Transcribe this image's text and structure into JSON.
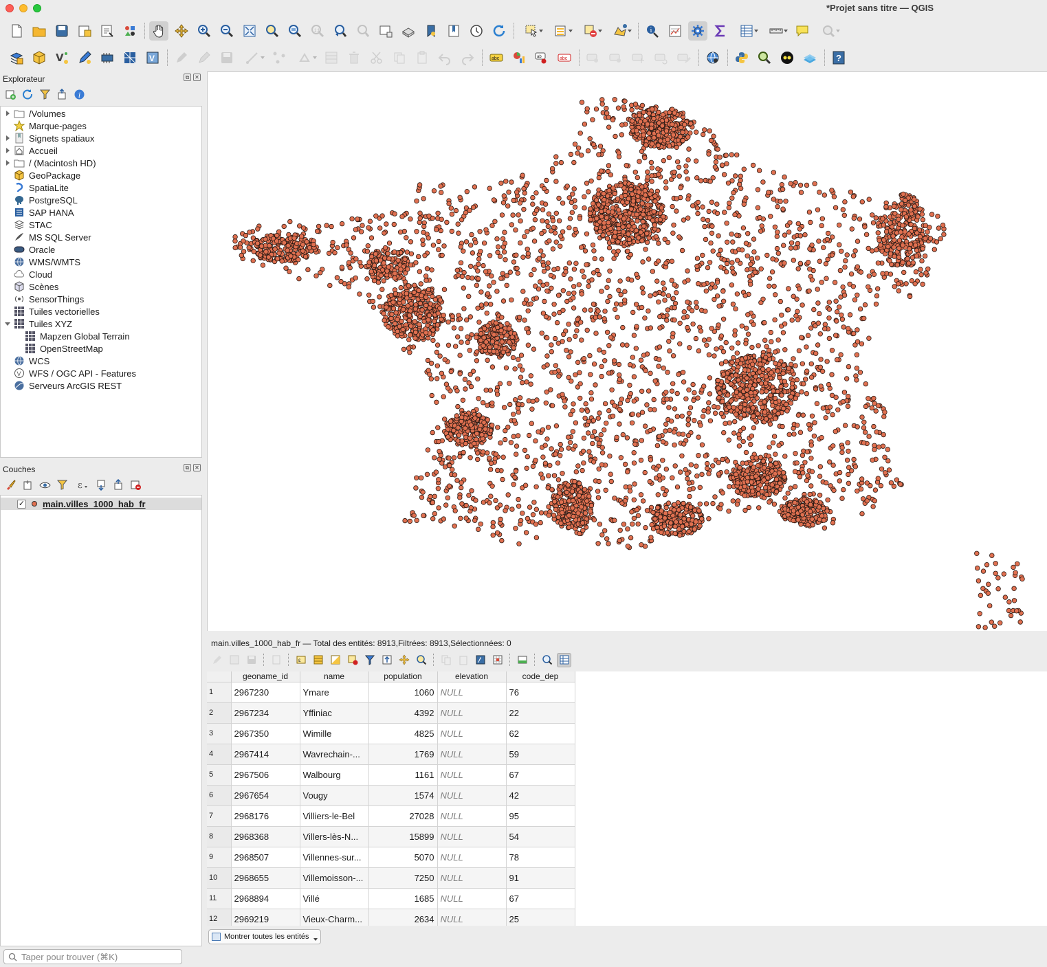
{
  "window": {
    "title": "*Projet sans titre — QGIS"
  },
  "explorer": {
    "title": "Explorateur",
    "items": [
      {
        "label": "/Volumes",
        "icon": "folder-icon",
        "arrow": "right",
        "indent": 0
      },
      {
        "label": "Marque-pages",
        "icon": "star-icon",
        "arrow": "none",
        "indent": 0
      },
      {
        "label": "Signets spatiaux",
        "icon": "bookmark-icon",
        "arrow": "right",
        "indent": 0
      },
      {
        "label": "Accueil",
        "icon": "home-icon",
        "arrow": "right",
        "indent": 0
      },
      {
        "label": "/ (Macintosh HD)",
        "icon": "folder-icon",
        "arrow": "right",
        "indent": 0
      },
      {
        "label": "GeoPackage",
        "icon": "geopackage-icon",
        "arrow": "none",
        "indent": 0
      },
      {
        "label": "SpatiaLite",
        "icon": "spatialite-icon",
        "arrow": "none",
        "indent": 0
      },
      {
        "label": "PostgreSQL",
        "icon": "postgresql-icon",
        "arrow": "none",
        "indent": 0
      },
      {
        "label": "SAP HANA",
        "icon": "saphana-icon",
        "arrow": "none",
        "indent": 0
      },
      {
        "label": "STAC",
        "icon": "stac-icon",
        "arrow": "none",
        "indent": 0
      },
      {
        "label": "MS SQL Server",
        "icon": "mssql-icon",
        "arrow": "none",
        "indent": 0
      },
      {
        "label": "Oracle",
        "icon": "oracle-icon",
        "arrow": "none",
        "indent": 0
      },
      {
        "label": "WMS/WMTS",
        "icon": "globe-icon",
        "arrow": "none",
        "indent": 0
      },
      {
        "label": "Cloud",
        "icon": "cloud-icon",
        "arrow": "none",
        "indent": 0
      },
      {
        "label": "Scènes",
        "icon": "cube-icon",
        "arrow": "none",
        "indent": 0
      },
      {
        "label": "SensorThings",
        "icon": "sensor-icon",
        "arrow": "none",
        "indent": 0
      },
      {
        "label": "Tuiles vectorielles",
        "icon": "grid-icon",
        "arrow": "none",
        "indent": 0
      },
      {
        "label": "Tuiles XYZ",
        "icon": "grid-icon",
        "arrow": "down",
        "indent": 0
      },
      {
        "label": "Mapzen Global Terrain",
        "icon": "grid-icon",
        "arrow": "none",
        "indent": 1
      },
      {
        "label": "OpenStreetMap",
        "icon": "grid-icon",
        "arrow": "none",
        "indent": 1
      },
      {
        "label": "WCS",
        "icon": "globe-icon",
        "arrow": "none",
        "indent": 0
      },
      {
        "label": "WFS / OGC API - Features",
        "icon": "wfs-icon",
        "arrow": "none",
        "indent": 0
      },
      {
        "label": "Serveurs ArcGIS REST",
        "icon": "arcgis-icon",
        "arrow": "none",
        "indent": 0
      }
    ]
  },
  "layers": {
    "title": "Couches",
    "items": [
      {
        "name": "main.villes_1000_hab_fr",
        "checked": true
      }
    ]
  },
  "search": {
    "placeholder": "Taper pour trouver (⌘K)"
  },
  "attribute_table": {
    "title": "main.villes_1000_hab_fr — Total des entités: 8913,Filtrées: 8913,Sélectionnées: 0",
    "columns": [
      "geoname_id",
      "name",
      "population",
      "elevation",
      "code_dep"
    ],
    "rows": [
      [
        "1",
        "2967230",
        "Ymare",
        "1060",
        "NULL",
        "76"
      ],
      [
        "2",
        "2967234",
        "Yffiniac",
        "4392",
        "NULL",
        "22"
      ],
      [
        "3",
        "2967350",
        "Wimille",
        "4825",
        "NULL",
        "62"
      ],
      [
        "4",
        "2967414",
        "Wavrechain-...",
        "1769",
        "NULL",
        "59"
      ],
      [
        "5",
        "2967506",
        "Walbourg",
        "1161",
        "NULL",
        "67"
      ],
      [
        "6",
        "2967654",
        "Vougy",
        "1574",
        "NULL",
        "42"
      ],
      [
        "7",
        "2968176",
        "Villiers-le-Bel",
        "27028",
        "NULL",
        "95"
      ],
      [
        "8",
        "2968368",
        "Villers-lès-N...",
        "15899",
        "NULL",
        "54"
      ],
      [
        "9",
        "2968507",
        "Villennes-sur...",
        "5070",
        "NULL",
        "78"
      ],
      [
        "10",
        "2968655",
        "Villemoisson-...",
        "7250",
        "NULL",
        "91"
      ],
      [
        "11",
        "2968894",
        "Villé",
        "1685",
        "NULL",
        "67"
      ],
      [
        "12",
        "2969219",
        "Vieux-Charm...",
        "2634",
        "NULL",
        "25"
      ]
    ],
    "show_all_label": "Montrer toutes les entités"
  },
  "map": {
    "point_fill": "#e07050",
    "point_stroke": "#2a1a14"
  }
}
